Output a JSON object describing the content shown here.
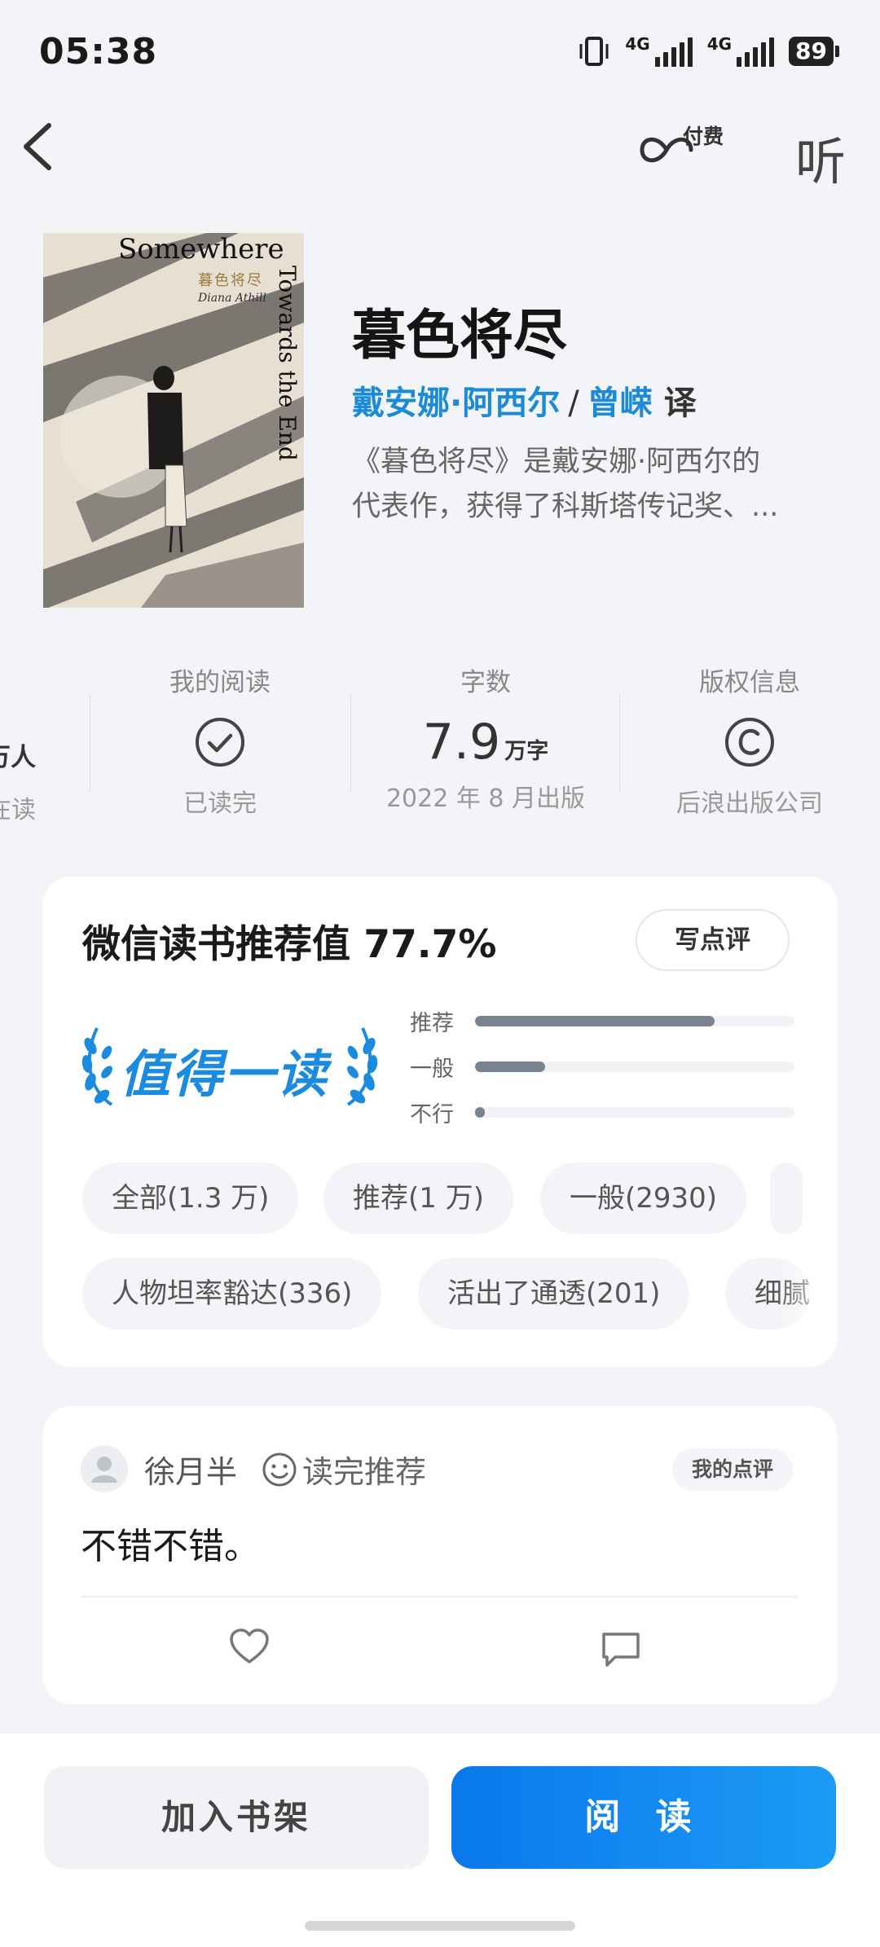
{
  "status_bar": {
    "time": "05:38",
    "net1": "4G",
    "net2": "4G",
    "battery": "89"
  },
  "nav": {
    "pay_label": "付费",
    "listen_label": "听"
  },
  "cover": {
    "title_en": "Somewhere",
    "side_en": "Towards the End",
    "title_cn": "暮色将尽",
    "author_en": "Diana Athill"
  },
  "book": {
    "title": "暮色将尽",
    "author": "戴安娜·阿西尔",
    "separator": "/",
    "translator": "曾嵘",
    "translator_suffix": "译",
    "description_line1": "《暮色将尽》是戴安娜·阿西尔的",
    "description_line2": "代表作，获得了科斯塔传记奖、..."
  },
  "stats": {
    "partial_top": "万人",
    "partial_bottom": "在读",
    "reading_label": "我的阅读",
    "reading_status": "已读完",
    "words_label": "字数",
    "words_value": "7.9",
    "words_unit": "万字",
    "words_sub": "2022 年 8 月出版",
    "copyright_label": "版权信息",
    "copyright_sub": "后浪出版公司"
  },
  "rating": {
    "title": "微信读书推荐值",
    "value": "77.7%",
    "write_button": "写点评",
    "badge": "值得一读",
    "bars": [
      {
        "label": "推荐",
        "fraction": 0.75
      },
      {
        "label": "一般",
        "fraction": 0.22
      },
      {
        "label": "不行",
        "fraction": 0.03
      }
    ],
    "filters_row1": [
      "全部(1.3 万)",
      "推荐(1 万)",
      "一般(2930)"
    ],
    "filters_row2": [
      "人物坦率豁达(336)",
      "活出了通透(201)",
      "细腻"
    ]
  },
  "review": {
    "user": "徐月半",
    "tag": "读完推荐",
    "my_review_badge": "我的点评",
    "content": "不错不错。"
  },
  "actions": {
    "shelf": "加入书架",
    "read": "阅 读"
  }
}
